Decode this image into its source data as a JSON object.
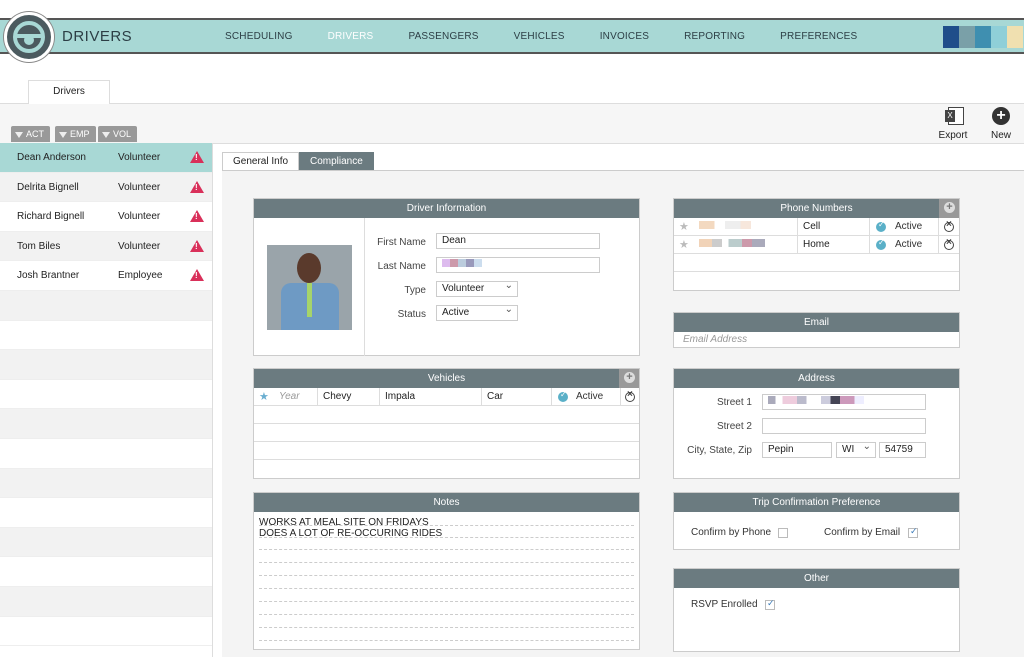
{
  "app": {
    "title": "DRIVERS"
  },
  "nav": [
    "SCHEDULING",
    "DRIVERS",
    "PASSENGERS",
    "VEHICLES",
    "INVOICES",
    "REPORTING",
    "PREFERENCES"
  ],
  "nav_active": "DRIVERS",
  "swatches": [
    "#1f4e8a",
    "#7aa0a8",
    "#3f8fb0",
    "#8fcfd8",
    "#f0e0b0"
  ],
  "subtab": "Drivers",
  "filters": [
    "ACT",
    "EMP",
    "VOL"
  ],
  "toolbar": {
    "export_label": "Export",
    "new_label": "New"
  },
  "drivers": [
    {
      "name": "Dean Anderson",
      "type": "Volunteer"
    },
    {
      "name": "Delrita Bignell",
      "type": "Volunteer"
    },
    {
      "name": "Richard Bignell",
      "type": "Volunteer"
    },
    {
      "name": "Tom Biles",
      "type": "Volunteer"
    },
    {
      "name": "Josh Brantner",
      "type": "Employee"
    }
  ],
  "detail_tabs": {
    "general": "General Info",
    "compliance": "Compliance"
  },
  "driver_info": {
    "header": "Driver Information",
    "first_name_label": "First Name",
    "first_name": "Dean",
    "last_name_label": "Last Name",
    "type_label": "Type",
    "type": "Volunteer",
    "status_label": "Status",
    "status": "Active"
  },
  "vehicles": {
    "header": "Vehicles",
    "year_placeholder": "Year",
    "make": "Chevy",
    "model": "Impala",
    "kind": "Car",
    "status": "Active"
  },
  "notes": {
    "header": "Notes",
    "lines": [
      "WORKS AT MEAL SITE ON FRIDAYS",
      "DOES A LOT OF RE-OCCURING RIDES"
    ]
  },
  "phones": {
    "header": "Phone Numbers",
    "rows": [
      {
        "type": "Cell",
        "status": "Active"
      },
      {
        "type": "Home",
        "status": "Active"
      }
    ]
  },
  "email": {
    "header": "Email",
    "placeholder": "Email Address"
  },
  "address": {
    "header": "Address",
    "street1_label": "Street 1",
    "street2_label": "Street 2",
    "csz_label": "City, State, Zip",
    "city": "Pepin",
    "state": "WI",
    "zip": "54759"
  },
  "trip_pref": {
    "header": "Trip Confirmation Preference",
    "phone_label": "Confirm by Phone",
    "email_label": "Confirm by Email",
    "phone_checked": false,
    "email_checked": true
  },
  "other": {
    "header": "Other",
    "rsvp_label": "RSVP Enrolled",
    "rsvp_checked": true
  }
}
